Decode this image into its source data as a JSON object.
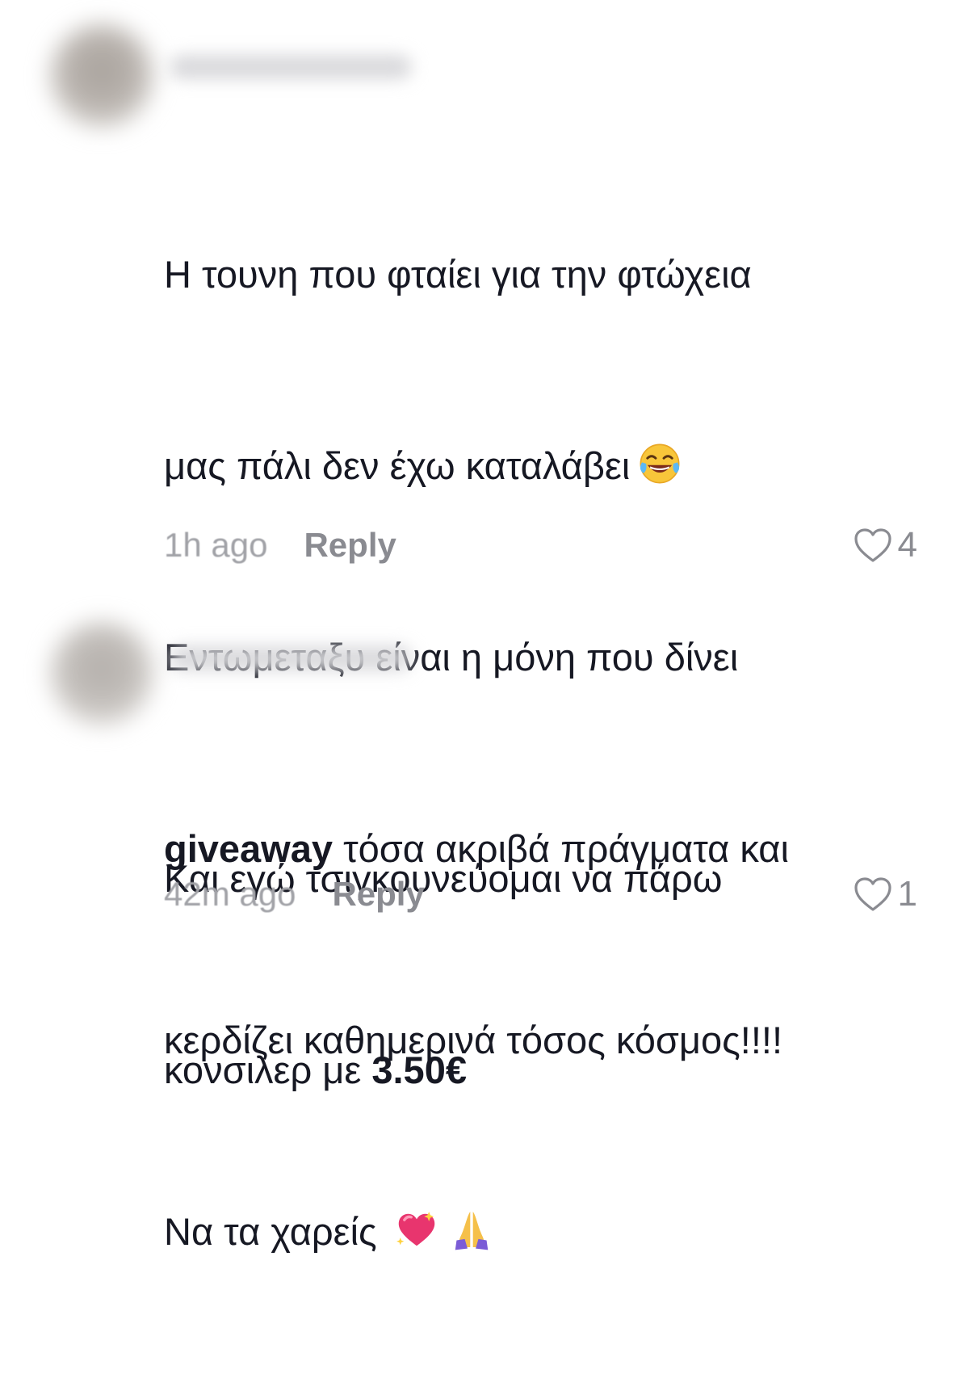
{
  "comments": [
    {
      "lines": [
        {
          "text": "Η τουνη που φταίει για την φτώχεια"
        },
        {
          "text": "μας πάλι δεν έχω καταλάβει",
          "emoji": "tears-of-joy-icon"
        },
        {
          "text": "Εντωμεταξυ είναι η μόνη που δίνει"
        },
        {
          "bold": "giveaway",
          "text": " τόσα ακριβά πράγματα και"
        },
        {
          "text": "κερδίζει καθημερινά τόσος κόσμος!!!!"
        },
        {
          "text": "Να τα χαρείς"
        }
      ],
      "time": "1h ago",
      "reply_label": "Reply",
      "likes": "4"
    },
    {
      "lines": [
        {
          "text": "Και εγώ τσιγκουνεύομαι να πάρω"
        },
        {
          "text": "κονσιλερ με ",
          "bold": "3.50€"
        }
      ],
      "time": "42m ago",
      "reply_label": "Reply",
      "likes": "1"
    }
  ],
  "colors": {
    "text": "#161823",
    "meta": "#a1a2a7",
    "reply": "#8a8b91"
  }
}
